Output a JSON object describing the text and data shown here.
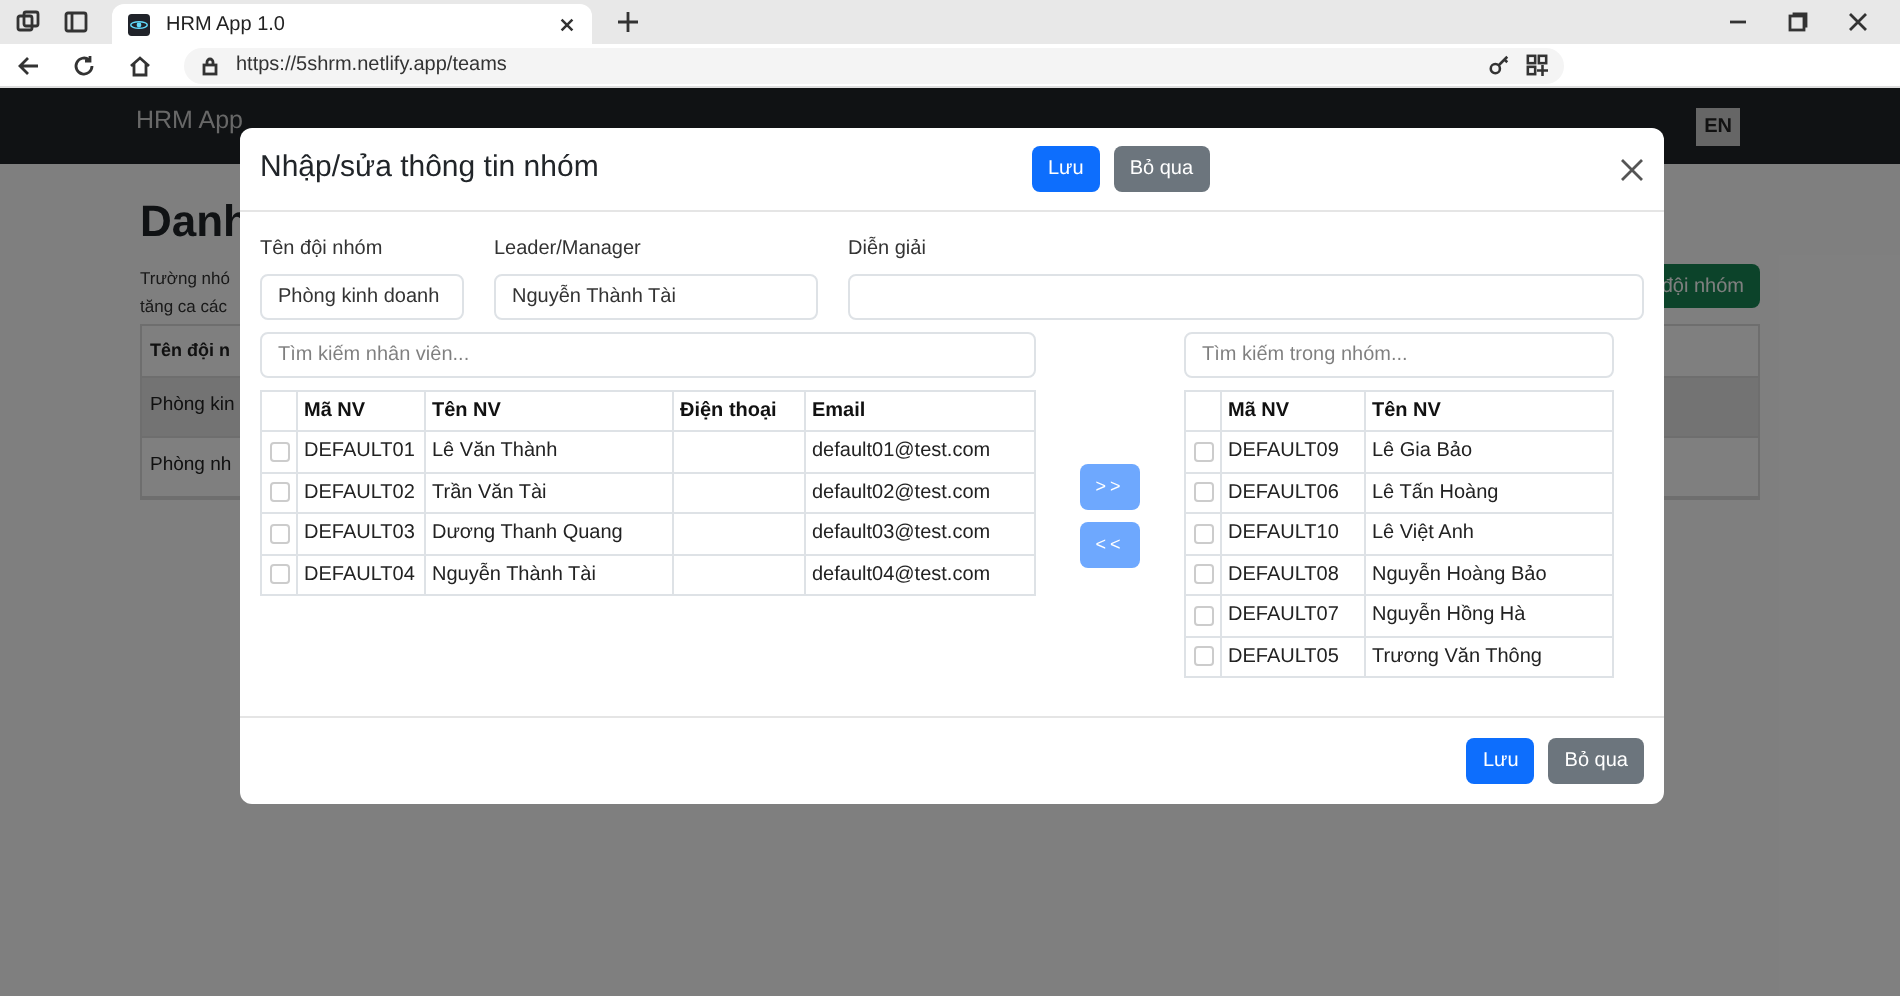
{
  "browser": {
    "tab_title": "HRM App 1.0",
    "url": "https://5shrm.netlify.app/teams"
  },
  "page": {
    "brand": "HRM App",
    "language": "EN",
    "heading": "Danh",
    "intro_lines": [
      "Trường nhó",
      "tăng ca các"
    ],
    "add_button": "đội nhóm",
    "table": {
      "columns": [
        "Tên đội n"
      ],
      "rows": [
        {
          "cells": [
            "Phòng kin"
          ],
          "selected": true
        },
        {
          "cells": [
            "Phòng nh"
          ],
          "selected": false
        }
      ]
    }
  },
  "modal": {
    "title": "Nhập/sửa thông tin nhóm",
    "header_buttons": [
      {
        "label": "Lưu",
        "kind": "primary"
      },
      {
        "label": "Bỏ qua",
        "kind": "secondary"
      }
    ],
    "fields": [
      {
        "label": "Tên đội nhóm",
        "value": "Phòng kinh doanh",
        "kind": "name"
      },
      {
        "label": "Leader/Manager",
        "value": "Nguyễn Thành Tài",
        "kind": "leader"
      },
      {
        "label": "Diễn giải",
        "kind": "note"
      }
    ],
    "employee_search": {
      "placeholder": "Tìm kiếm nhân viên..."
    },
    "employees": {
      "columns": [
        "Mã NV",
        "Tên NV",
        "Điện thoại",
        "Email"
      ],
      "rows": [
        {
          "checked": false,
          "cells": [
            "DEFAULT01",
            "Lê Văn Thành",
            "",
            "default01@test.com"
          ]
        },
        {
          "checked": false,
          "cells": [
            "DEFAULT02",
            "Trần Văn Tài",
            "",
            "default02@test.com"
          ]
        },
        {
          "checked": false,
          "cells": [
            "DEFAULT03",
            "Dương Thanh Quang",
            "",
            "default03@test.com"
          ]
        },
        {
          "checked": false,
          "cells": [
            "DEFAULT04",
            "Nguyễn Thành Tài",
            "",
            "default04@test.com"
          ]
        }
      ]
    },
    "move_buttons": [
      ">>",
      "<<"
    ],
    "member_search": {
      "placeholder": "Tìm kiếm trong nhóm..."
    },
    "members": {
      "columns": [
        "Mã NV",
        "Tên NV"
      ],
      "rows": [
        {
          "checked": false,
          "cells": [
            "DEFAULT09",
            "Lê Gia Bảo"
          ]
        },
        {
          "checked": false,
          "cells": [
            "DEFAULT06",
            "Lê Tấn Hoàng"
          ]
        },
        {
          "checked": false,
          "cells": [
            "DEFAULT10",
            "Lê Việt Anh"
          ]
        },
        {
          "checked": false,
          "cells": [
            "DEFAULT08",
            "Nguyễn Hoàng Bảo"
          ]
        },
        {
          "checked": false,
          "cells": [
            "DEFAULT07",
            "Nguyễn Hồng Hà"
          ]
        },
        {
          "checked": false,
          "cells": [
            "DEFAULT05",
            "Trương Văn Thông"
          ]
        }
      ]
    },
    "footer_buttons": [
      {
        "label": "Lưu",
        "kind": "primary"
      },
      {
        "label": "Bỏ qua",
        "kind": "secondary"
      }
    ]
  }
}
